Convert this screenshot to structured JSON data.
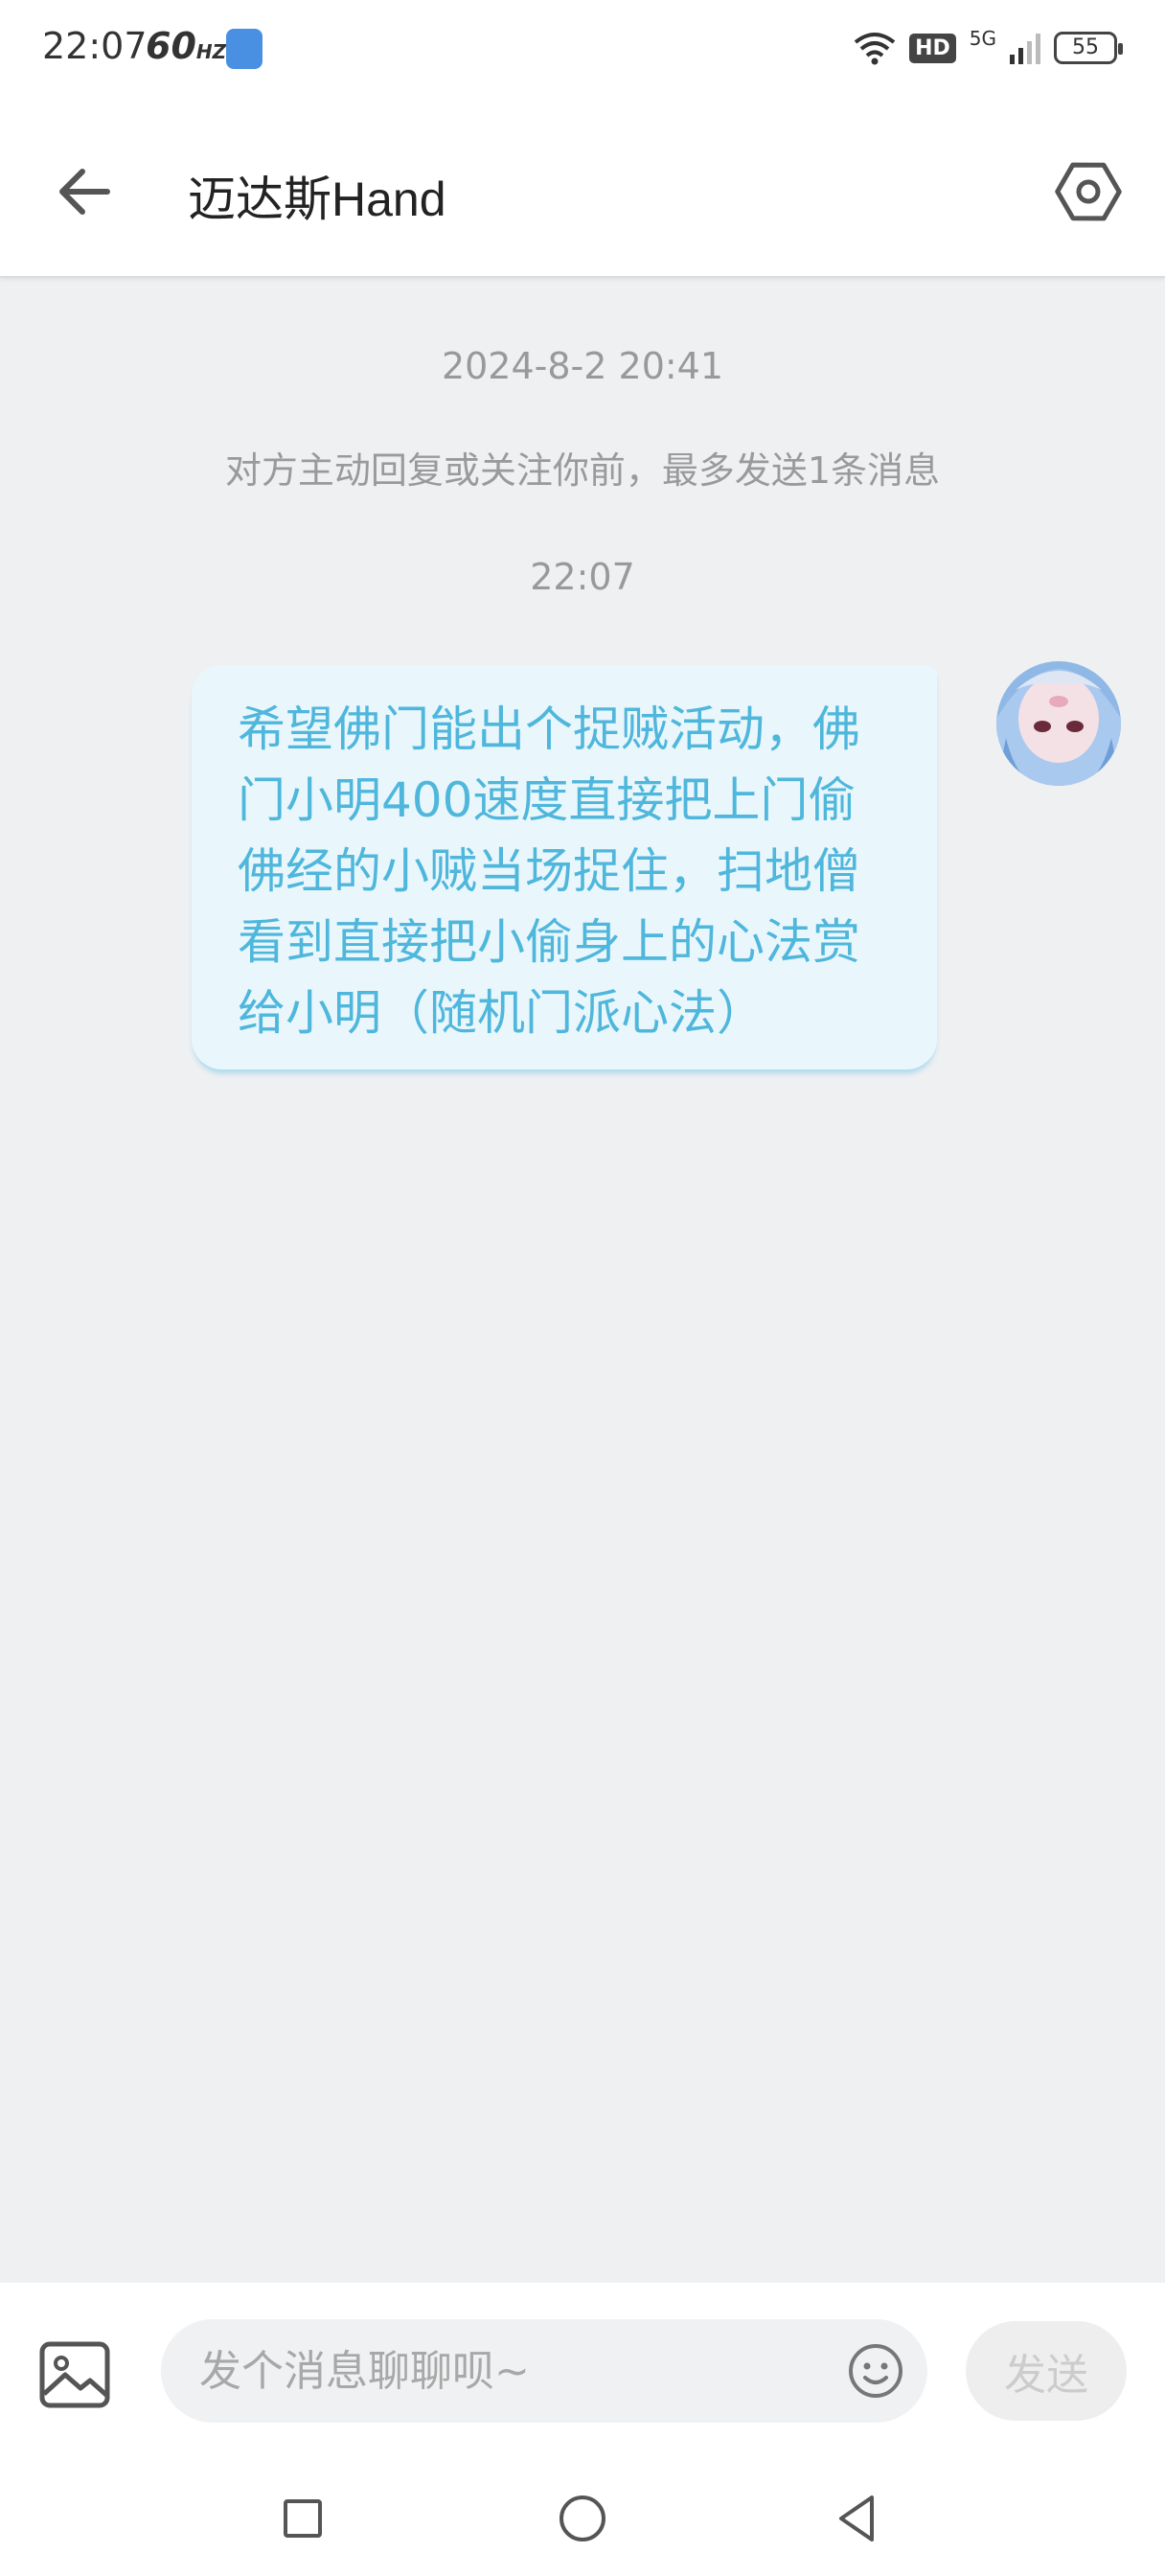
{
  "status_bar": {
    "time": "22:07",
    "refresh_rate": "60",
    "refresh_unit": "HZ",
    "hd_badge": "HD",
    "network": "5G",
    "battery": "55"
  },
  "header": {
    "title": "迈达斯Hand",
    "back_icon": "arrow-left-icon",
    "settings_icon": "hexagon-settings-icon"
  },
  "chat": {
    "timestamp_1": "2024-8-2 20:41",
    "notice": "对方主动回复或关注你前，最多发送1条消息",
    "timestamp_2": "22:07",
    "messages": [
      {
        "side": "right",
        "text": "希望佛门能出个捉贼活动，佛门小明400速度直接把上门偷佛经的小贼当场捉住，扫地僧看到直接把小偷身上的心法赏给小明（随机门派心法）"
      }
    ]
  },
  "input_bar": {
    "placeholder": "发个消息聊聊呗~",
    "send_label": "发送",
    "image_icon": "image-icon",
    "emoji_icon": "emoji-icon"
  },
  "nav_bar": {
    "recent_icon": "square-icon",
    "home_icon": "circle-icon",
    "back_icon": "triangle-back-icon"
  },
  "colors": {
    "bubble_bg": "#e9f7fc",
    "bubble_text": "#4fb6dc",
    "page_bg": "#eff0f2"
  }
}
